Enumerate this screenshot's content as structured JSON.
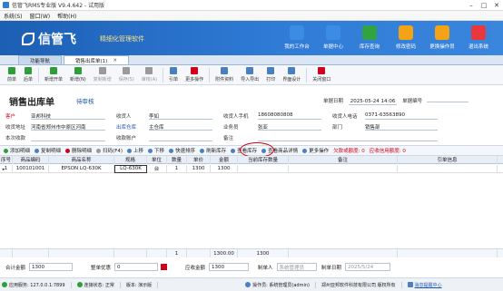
{
  "window": {
    "title": "信管飞RMS专业版 V9.4.642 - 试用版"
  },
  "menu": [
    "系统(S)",
    "窗口(W)",
    "帮助(H)"
  ],
  "banner": {
    "brand": "信管飞",
    "slogan": "精细化管理软件",
    "quick": [
      {
        "label": "我的工作台",
        "icon": "monitor-icon",
        "color": "#3b8de3"
      },
      {
        "label": "单据中心",
        "icon": "document-list-icon",
        "color": "#3b8de3"
      },
      {
        "label": "库存查询",
        "icon": "warehouse-icon",
        "color": "#31a343"
      },
      {
        "label": "修改密码",
        "icon": "lock-icon",
        "color": "#f2a316"
      },
      {
        "label": "更换操作员",
        "icon": "user-switch-icon",
        "color": "#f2a316"
      },
      {
        "label": "退出系统",
        "icon": "power-icon",
        "color": "#e8383d"
      }
    ]
  },
  "tabs": [
    {
      "label": "功能导航",
      "closable": false
    },
    {
      "label": "销售出库单(1)",
      "closable": true
    }
  ],
  "toolbar": [
    {
      "label": "前单",
      "color": "#2e9e3a"
    },
    {
      "label": "后单",
      "color": "#2e9e3a"
    },
    {
      "label": "新增开单",
      "color": "#2e9e3a"
    },
    {
      "label": "新增(N)",
      "color": "#2e9e3a"
    },
    {
      "label": "复制新增",
      "color": "#9a9a9a",
      "disabled": true
    },
    {
      "label": "保存(S)",
      "color": "#9a9a9a",
      "disabled": true
    },
    {
      "label": "审核(A)",
      "color": "#9a9a9a",
      "disabled": true
    },
    {
      "label": "引单",
      "color": "#4a7fc1"
    },
    {
      "label": "更多操作",
      "color": "#d0021b"
    },
    {
      "label": "附件资料",
      "color": "#4a7fc1"
    },
    {
      "label": "导入导出",
      "color": "#4a7fc1"
    },
    {
      "label": "打印",
      "color": "#4a7fc1"
    },
    {
      "label": "界面设计",
      "color": "#4a7fc1"
    },
    {
      "label": "关闭窗口",
      "color": "#d0021b"
    }
  ],
  "doc": {
    "title": "销售出库单",
    "status": "待审核",
    "date_label": "单据日期",
    "date_value": "2025-05-24 14:06",
    "number_label": "单据编号",
    "customer_label": "客户",
    "customer_value": "亚邦科技",
    "receiver_label": "收货人",
    "receiver_value": "李如",
    "receiver_mobile_label": "收货人手机",
    "receiver_mobile_value": "18608080808",
    "receiver_phone_label": "收货人电话",
    "receiver_phone_value": "0371-63563890",
    "address_label": "收货地址",
    "address_value": "河南省郑州市中原区河南",
    "warehouse_label": "出库仓库",
    "warehouse_value": "主仓库",
    "salesman_label": "业务员",
    "salesman_value": "张亚",
    "dept_label": "部门",
    "dept_value": "销售部",
    "received_label": "本次收款",
    "account_label": "收款账户",
    "remark_label": "备注"
  },
  "gridbar": {
    "buttons": [
      {
        "label": "添加明细",
        "color": "#2e9e3a"
      },
      {
        "label": "复制明细",
        "color": "#4a7fc1"
      },
      {
        "label": "删除明细",
        "color": "#d0021b"
      },
      {
        "label": "扫码(F4)",
        "color": "#9a9a9a"
      },
      {
        "label": "上移",
        "color": "#4a7fc1"
      },
      {
        "label": "下移",
        "color": "#4a7fc1"
      },
      {
        "label": "快速排序",
        "color": "#4a7fc1"
      },
      {
        "label": "刷新库存",
        "color": "#4a7fc1"
      },
      {
        "label": "查看库存",
        "color": "#4a7fc1"
      },
      {
        "label": "查看商品详情",
        "color": "#4a7fc1"
      },
      {
        "label": "更多操作",
        "color": "#4a7fc1"
      }
    ],
    "alerts": [
      "欠款或额度: 0",
      "应收信用额度: 0"
    ]
  },
  "grid": {
    "columns": [
      "序号",
      "商品编码",
      "商品名称",
      "规格",
      "单位",
      "数量",
      "单价",
      "金额",
      "当前库存数量",
      "备注",
      "引单信息"
    ],
    "rows": [
      [
        "1",
        "100101001",
        "EPSON LQ-630K",
        "LQ-630K",
        "台",
        "1",
        "1300",
        "1300",
        "",
        "",
        ""
      ]
    ],
    "footer": {
      "qty": "1",
      "amount": "1300.00",
      "stock": "1300"
    }
  },
  "summary": {
    "total_label": "合计金额",
    "total_value": "1300",
    "discount_label": "整单优惠",
    "discount_value": "0",
    "receivable_label": "应收金额",
    "receivable_value": "1300",
    "maker_label": "制单人",
    "maker_value": "系统管理员",
    "make_date_label": "制单日期",
    "make_date_value": "2025/5/24"
  },
  "statusbar": {
    "server": "应用服务: 127.0.0.1:7899",
    "connection": "连接状态: 正常",
    "version": "版本: 演示版",
    "operator": "操作员: 系统管理员(admin)",
    "copyright": "郑州亚邦软件科技有限公司 版权所有",
    "messages": "消息提醒中心"
  }
}
